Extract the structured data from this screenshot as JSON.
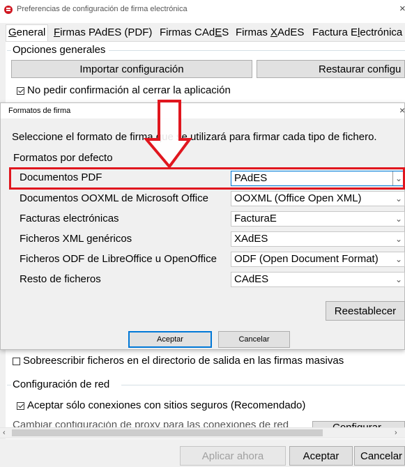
{
  "main_window": {
    "title": "Preferencias de configuración de firma electrónica",
    "close_glyph": "×",
    "tabs": [
      {
        "prefix": "",
        "accel": "G",
        "rest": "eneral"
      },
      {
        "prefix": "",
        "accel": "F",
        "rest": "irmas PAdES (PDF)"
      },
      {
        "prefix": "Firmas CAd",
        "accel": "E",
        "rest": "S"
      },
      {
        "prefix": "Firmas ",
        "accel": "X",
        "rest": "AdES"
      },
      {
        "prefix": "Factura E",
        "accel": "l",
        "rest": "ectrónica"
      }
    ],
    "general_options_legend": "Opciones generales",
    "import_button": "Importar configuración",
    "restore_button": "Restaurar configu",
    "no_confirm_checkbox": "No pedir confirmación al cerrar la aplicación",
    "overwrite_checkbox": "Sobreescribir ficheros en el directorio de salida en las firmas masivas",
    "network_legend": "Configuración de red",
    "secure_connections_checkbox": "Aceptar sólo conexiones con sitios seguros (Recomendado)",
    "clipped_row_text": "Cambiar configuración de proxy para las conexiones de red",
    "clipped_button": "Configurar",
    "apply_now_button": "Aplicar ahora",
    "accept_button": "Aceptar",
    "cancel_button": "Cancelar"
  },
  "dialog": {
    "title": "Formatos de firma",
    "close_glyph": "×",
    "instruction": "Seleccione el formato de firma que se utilizará para firmar cada tipo de fichero.",
    "section_title": "Formatos por defecto",
    "rows": [
      {
        "label": "Documentos PDF",
        "value": "PAdES"
      },
      {
        "label": "Documentos OOXML de Microsoft Office",
        "value": "OOXML (Office Open XML)"
      },
      {
        "label": "Facturas electrónicas",
        "value": "FacturaE"
      },
      {
        "label": "Ficheros XML genéricos",
        "value": "XAdES"
      },
      {
        "label": "Ficheros ODF de LibreOffice u OpenOffice",
        "value": "ODF (Open Document Format)"
      },
      {
        "label": "Resto de ficheros",
        "value": "CAdES"
      }
    ],
    "reset_button": "Reestablecer",
    "accept_button": "Aceptar",
    "cancel_button": "Cancelar"
  },
  "colors": {
    "annotation_red": "#e0161e",
    "focus_blue": "#0078d7"
  },
  "icons": {
    "app_icon": "red-circle-app-icon",
    "chevron": "chevron-down-icon",
    "arrow": "red-down-arrow-annotation"
  }
}
